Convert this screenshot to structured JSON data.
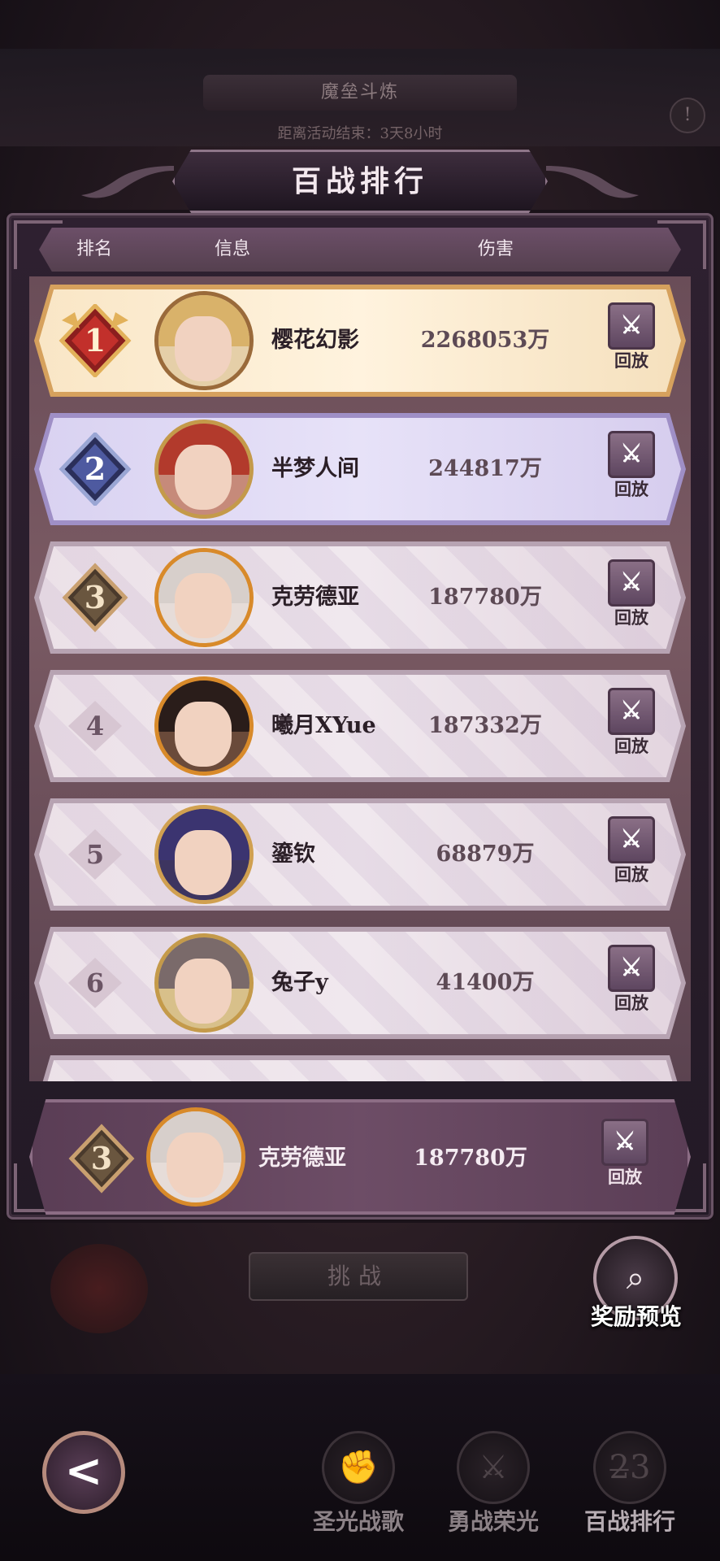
{
  "background": {
    "event_title": "魔垒斗炼",
    "event_timer": "距离活动结束：3天8小时",
    "info_icon": "!",
    "challenge_label": "挑战"
  },
  "panel": {
    "title": "百战排行",
    "columns": {
      "rank": "排名",
      "info": "信息",
      "damage": "伤害"
    }
  },
  "rows": [
    {
      "rank": "1",
      "name": "樱花幻影",
      "damage": "2268053万",
      "replay": "回放",
      "style": "gold"
    },
    {
      "rank": "2",
      "name": "半梦人间",
      "damage": "244817万",
      "replay": "回放",
      "style": "silver"
    },
    {
      "rank": "3",
      "name": "克劳德亚",
      "damage": "187780万",
      "replay": "回放",
      "style": "bronze"
    },
    {
      "rank": "4",
      "name": "曦月XYue",
      "damage": "187332万",
      "replay": "回放",
      "style": "plain"
    },
    {
      "rank": "5",
      "name": "鎏钦",
      "damage": "68879万",
      "replay": "回放",
      "style": "plain"
    },
    {
      "rank": "6",
      "name": "兔子y",
      "damage": "41400万",
      "replay": "回放",
      "style": "plain"
    }
  ],
  "my_rank": {
    "rank": "3",
    "name": "克劳德亚",
    "damage": "187780万",
    "replay": "回放"
  },
  "reward_preview": {
    "label": "奖励预览"
  },
  "bottom_nav": {
    "back_icon": "<",
    "items": [
      {
        "label": "圣光战歌",
        "glyph": "✊"
      },
      {
        "label": "勇战荣光",
        "glyph": "⚔"
      },
      {
        "label": "百战排行",
        "glyph": "2̶3"
      }
    ]
  },
  "colors": {
    "gold_row": "#fff3de",
    "silver_row": "#e7e2f8",
    "plain_row": "#f0e8ee",
    "my_row": "#6d4d66",
    "header_bar": "#6c4f68"
  }
}
